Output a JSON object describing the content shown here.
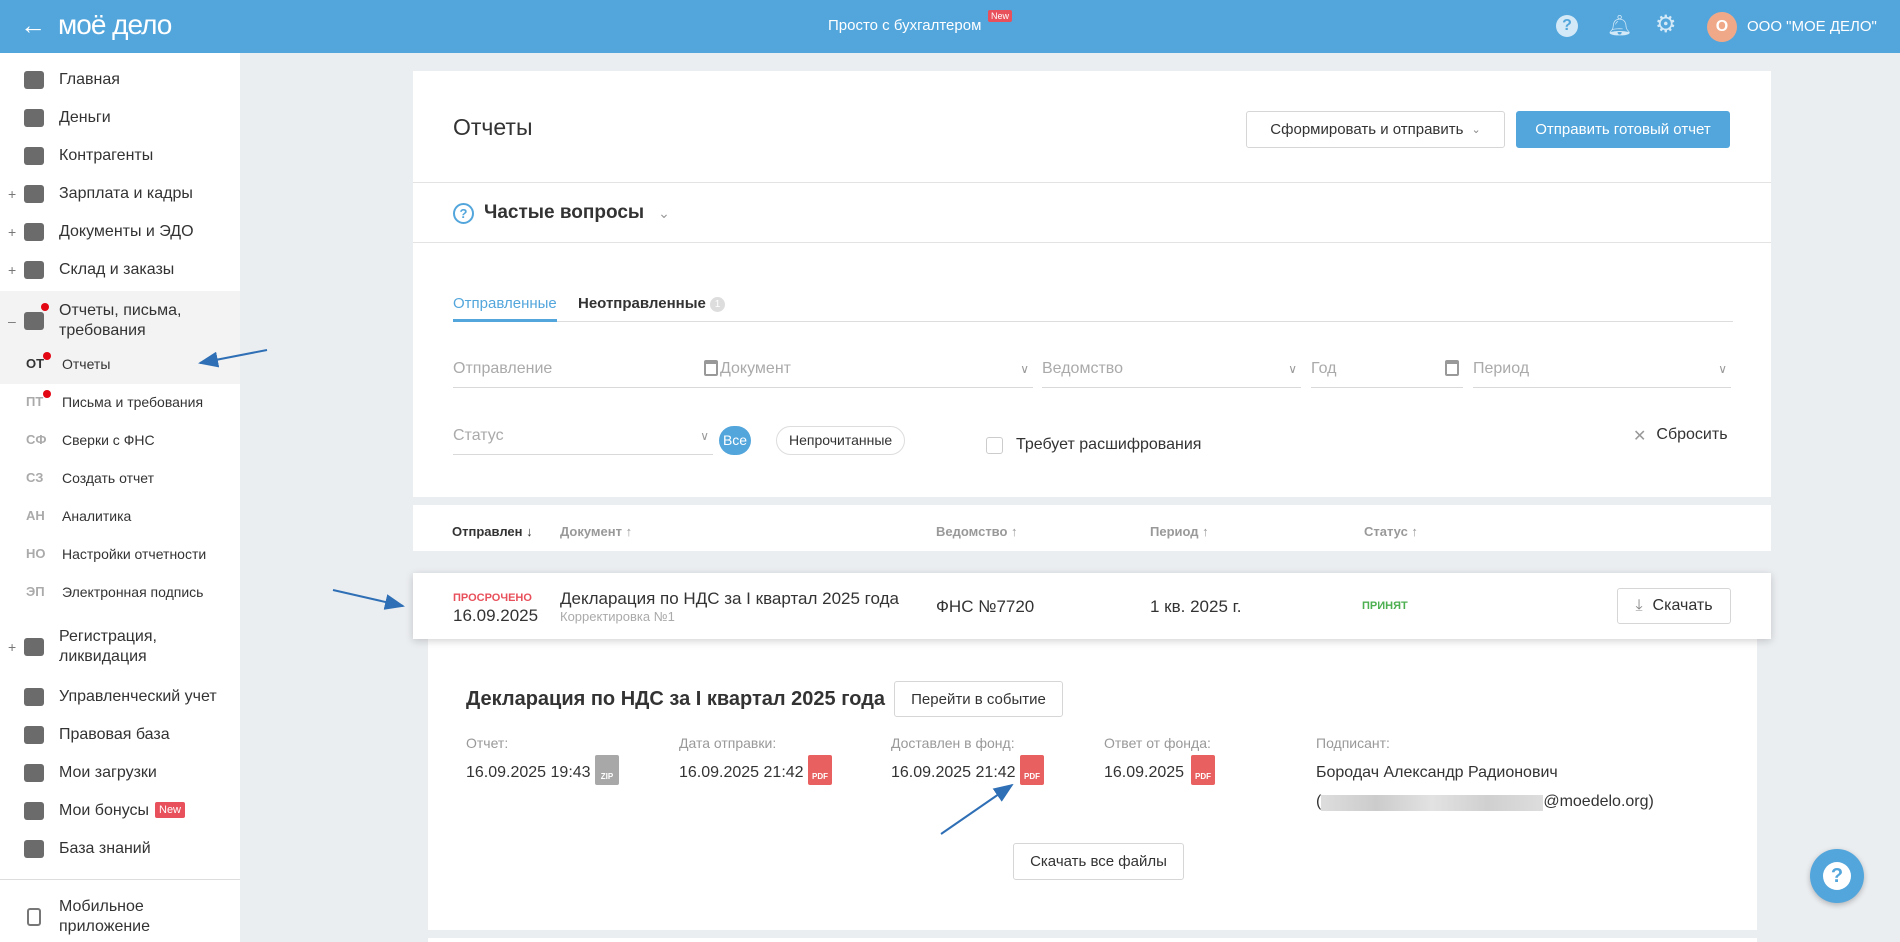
{
  "header": {
    "logo": "моё дело",
    "promo": "Просто с бухгалтером",
    "promo_badge": "New",
    "company_initial": "О",
    "company": "ООО \"МОЕ ДЕЛО\""
  },
  "sidebar": {
    "items": [
      {
        "label": "Главная"
      },
      {
        "label": "Деньги"
      },
      {
        "label": "Контрагенты"
      },
      {
        "label": "Зарплата и кадры"
      },
      {
        "label": "Документы и ЭДО"
      },
      {
        "label": "Склад и заказы"
      },
      {
        "label": "Отчеты, письма, требования"
      }
    ],
    "sub_items": [
      {
        "abbr": "ОТ",
        "label": "Отчеты"
      },
      {
        "abbr": "ПТ",
        "label": "Письма и требования"
      },
      {
        "abbr": "СФ",
        "label": "Сверки с ФНС"
      },
      {
        "abbr": "СЗ",
        "label": "Создать отчет"
      },
      {
        "abbr": "АН",
        "label": "Аналитика"
      },
      {
        "abbr": "НО",
        "label": "Настройки отчетности"
      },
      {
        "abbr": "ЭП",
        "label": "Электронная подпись"
      }
    ],
    "bottom_items": [
      {
        "label": "Регистрация, ликвидация"
      },
      {
        "label": "Управленческий учет"
      },
      {
        "label": "Правовая база"
      },
      {
        "label": "Мои загрузки"
      },
      {
        "label": "Мои бонусы",
        "badge": "New"
      },
      {
        "label": "База знаний"
      },
      {
        "label": "Мобильное приложение"
      }
    ]
  },
  "page": {
    "title": "Отчеты",
    "form_send": "Сформировать и отправить",
    "send_ready": "Отправить готовый отчет",
    "faq": "Частые вопросы",
    "tabs": [
      {
        "label": "Отправленные"
      },
      {
        "label": "Неотправленные",
        "count": "1"
      }
    ],
    "filters": {
      "sent": "Отправление",
      "document": "Документ",
      "agency": "Ведомство",
      "year": "Год",
      "period": "Период",
      "status": "Статус",
      "all": "Все",
      "unread": "Непрочитанные",
      "decrypt": "Требует расшифрования",
      "reset": "Сбросить"
    }
  },
  "table": {
    "columns": [
      "Отправлен ↓",
      "Документ ↑",
      "Ведомство ↑",
      "Период ↑",
      "Статус ↑"
    ],
    "row": {
      "overdue": "ПРОСРОЧЕНО",
      "date": "16.09.2025",
      "document": "Декларация по НДС за I квартал 2025 года",
      "correction": "Корректировка №1",
      "agency": "ФНС №7720",
      "period": "1 кв. 2025 г.",
      "status": "ПРИНЯТ",
      "download": "Скачать"
    }
  },
  "details": {
    "title": "Декларация по НДС за I квартал 2025 года",
    "goto": "Перейти в событие",
    "cols": [
      {
        "label": "Отчет:",
        "value": "16.09.2025 19:43",
        "file": "ZIP"
      },
      {
        "label": "Дата отправки:",
        "value": "16.09.2025 21:42",
        "file": "PDF"
      },
      {
        "label": "Доставлен в фонд:",
        "value": "16.09.2025 21:42",
        "file": "PDF"
      },
      {
        "label": "Ответ от фонда:",
        "value": "16.09.2025",
        "file": "PDF"
      }
    ],
    "signer_label": "Подписант:",
    "signer": "Бородач Александр Радионович",
    "email_prefix": "(",
    "email_suffix": "@moedelo.org)",
    "download_all": "Скачать все файлы"
  },
  "colors": {
    "brand": "#53a6dc",
    "overdue": "#e8505b",
    "accepted": "#4caf50"
  }
}
